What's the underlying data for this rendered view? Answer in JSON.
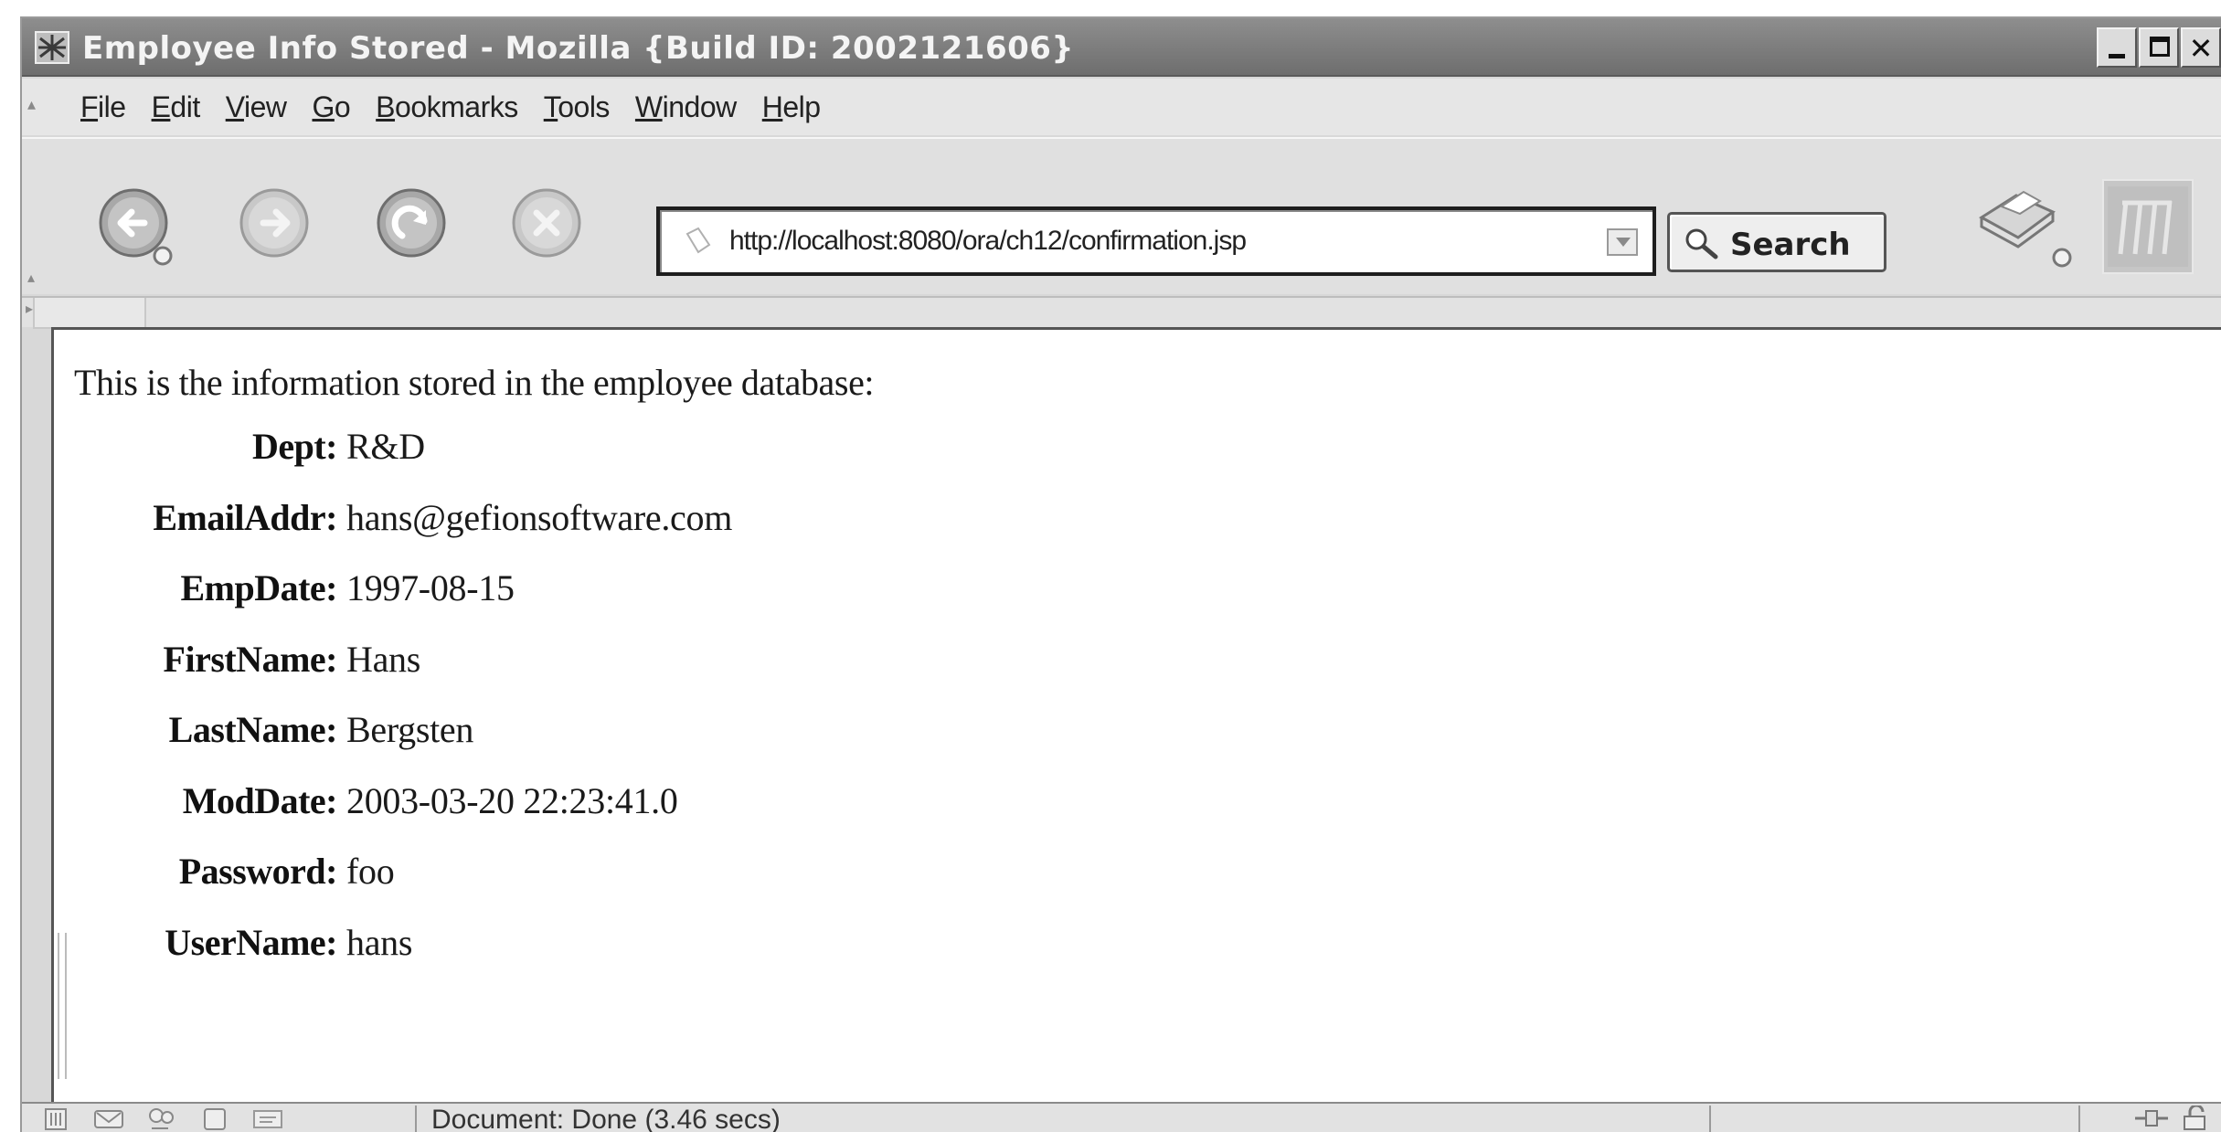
{
  "window": {
    "title": "Employee Info Stored - Mozilla {Build ID: 2002121606}"
  },
  "menu": {
    "items": [
      {
        "key": "F",
        "rest": "ile"
      },
      {
        "key": "E",
        "rest": "dit"
      },
      {
        "key": "V",
        "rest": "iew"
      },
      {
        "key": "G",
        "rest": "o"
      },
      {
        "key": "B",
        "rest": "ookmarks"
      },
      {
        "key": "T",
        "rest": "ools"
      },
      {
        "key": "W",
        "rest": "indow"
      },
      {
        "key": "H",
        "rest": "elp"
      }
    ]
  },
  "toolbar": {
    "url": "http://localhost:8080/ora/ch12/confirmation.jsp",
    "search_label": "Search"
  },
  "page": {
    "intro": "This is the information stored in the employee database:",
    "fields": [
      {
        "label": "Dept:",
        "value": "R&D"
      },
      {
        "label": "EmailAddr:",
        "value": "hans@gefionsoftware.com"
      },
      {
        "label": "EmpDate:",
        "value": "1997-08-15"
      },
      {
        "label": "FirstName:",
        "value": "Hans"
      },
      {
        "label": "LastName:",
        "value": "Bergsten"
      },
      {
        "label": "ModDate:",
        "value": "2003-03-20 22:23:41.0"
      },
      {
        "label": "Password:",
        "value": "foo"
      },
      {
        "label": "UserName:",
        "value": "hans"
      }
    ]
  },
  "status": {
    "text": "Document: Done (3.46 secs)"
  },
  "icons": {
    "back": "back-arrow-icon",
    "forward": "forward-arrow-icon",
    "reload": "reload-icon",
    "stop": "stop-icon",
    "print": "print-icon",
    "throbber": "mozilla-logo-icon",
    "search": "magnifier-icon"
  }
}
